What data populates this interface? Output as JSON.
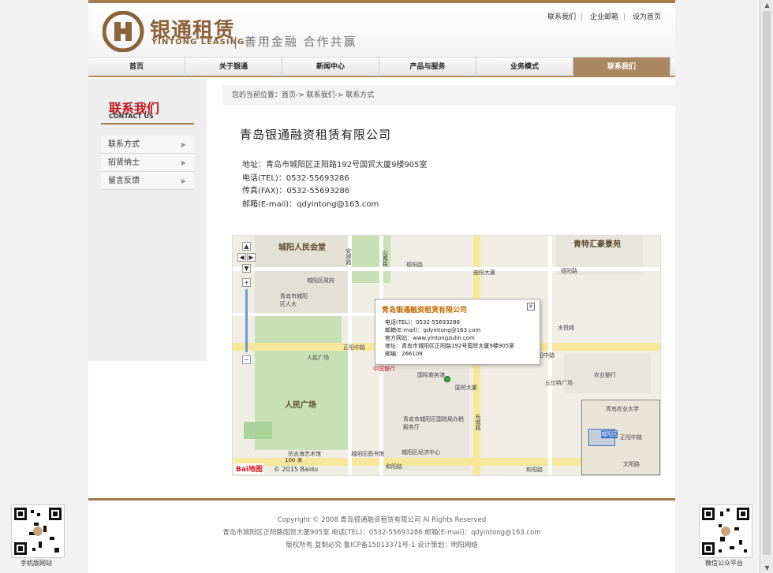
{
  "header": {
    "brand_cn": "银通租赁",
    "brand_en": "YINTONG LEASING",
    "slogan": "善用金融  合作共赢",
    "top_links": [
      "联系我们",
      "企业邮箱",
      "设为首页"
    ]
  },
  "nav": [
    "首页",
    "关于银通",
    "新闻中心",
    "产品与服务",
    "业务模式",
    "联系我们"
  ],
  "nav_active": "联系我们",
  "sidebar": {
    "title": "联系我们",
    "subtitle": "CONTACT US",
    "items": [
      "联系方式",
      "招贤纳士",
      "留言反馈"
    ]
  },
  "breadcrumb": "您的当前位置：首页-> 联系我们-> 联系方式",
  "company": "青岛银通融资租赁有限公司",
  "info": [
    "地址：青岛市城阳区正阳路192号国贸大厦9楼905室",
    "电话(TEL)：0532-55693286",
    "传真(FAX)：0532-55693286",
    "邮箱(E-mail)：qdyintong@163.com"
  ],
  "map": {
    "labels": {
      "people_hall": "城阳人民会堂",
      "qingte": "青特汇豪景苑",
      "people_square": "人民广场",
      "square_small": "人民广场",
      "district_gov": "城阳区政府",
      "people_gov": "青岛市城阳区人大",
      "quyang": "曲阳大厦",
      "zhengyang_rd": "正阳中路",
      "zhengyang_rd2": "正阳中路",
      "deyang": "德阳路",
      "deyang2": "德阳路",
      "heyang": "和阳路",
      "heyang2": "和阳路",
      "bank": "中国银行",
      "guomao": "国贸大厦",
      "guojishangwu": "国际商务港",
      "changcheng": "长城路",
      "anshun": "安顺路",
      "shancheng": "山城路",
      "agri_bank": "农业银行",
      "shuiyuan": "水悦城",
      "culture": "仿志海艺术馆",
      "bureau": "青岛市城阳区国税局办税服务厅",
      "economy": "城阳区经济中心",
      "library": "城阳区图书馆",
      "xiaoqu": "丘比特广场",
      "nongda": "青岛农业大学",
      "wenyang": "文阳路",
      "cyq": "城阳区",
      "zyz": "正阳中路"
    },
    "popup": {
      "title": "青岛银通融资租赁有限公司",
      "lines": [
        "电话(TEL)：0532-55693286",
        "邮箱(E-mail)：qdyintong@163.com",
        "官方网站：www.yintongzulin.com",
        "地址：青岛市城阳区正阳路192号国贸大厦9楼905室",
        "邮编：266109"
      ]
    },
    "scale": "100 米",
    "copyright": "© 2015 Baidu",
    "logo": "Bai地图"
  },
  "footer": {
    "lines": [
      "Copyright © 2008 青岛银通融资租赁有限公司  Al Rights Reserved",
      "青岛市城阳区正阳路国贸大厦905室  电话(TEL)：0532-55693286  邮箱(E-mail)：qdyintong@163.com",
      "版权所有  复制必究  鲁ICP备15013371号-1  设计策划：明阳网络"
    ],
    "qr_left_caption": "手机版网站",
    "qr_right_caption": "微信公众平台"
  }
}
